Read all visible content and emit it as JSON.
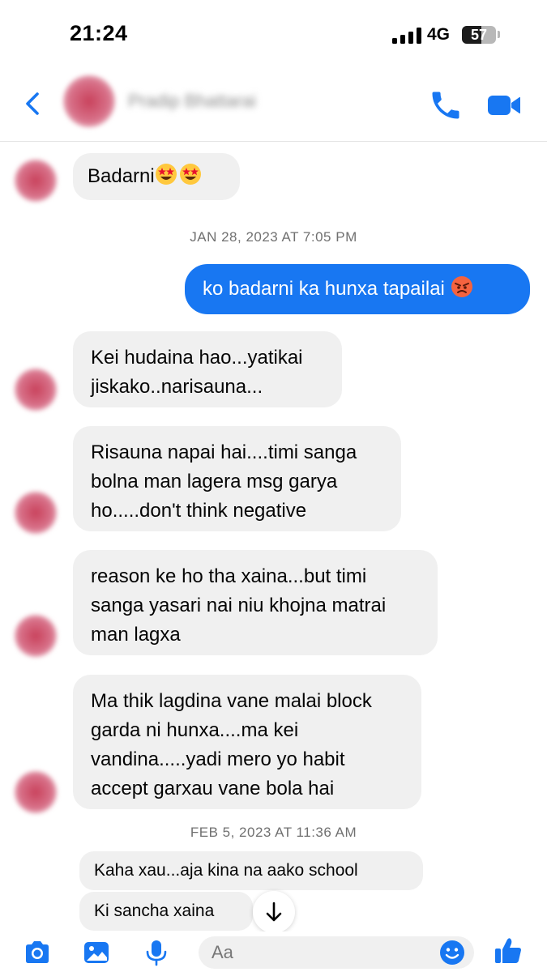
{
  "status": {
    "time": "21:24",
    "network": "4G",
    "battery": "57",
    "battery_level": 0.57
  },
  "header": {
    "contact_name": "Pradip Bhattarai"
  },
  "colors": {
    "accent": "#1877f2",
    "incoming_bubble": "#f0f0f0",
    "timestamp": "#707070"
  },
  "messages": {
    "m1": "Badarni",
    "ts1": "JAN 28, 2023 AT 7:05 PM",
    "m2": "ko badarni ka hunxa tapailai",
    "m3": "Kei hudaina hao...yatikai jiskako..narisauna...",
    "m4": "Risauna napai hai....timi sanga bolna man lagera msg garya ho.....don't think negative",
    "m5": "reason ke ho tha xaina...but timi sanga yasari nai niu khojna matrai man lagxa",
    "m6": "Ma thik lagdina vane malai block garda ni hunxa....ma kei vandina.....yadi mero yo habit accept garxau vane bola hai",
    "ts2": "FEB 5, 2023 AT 11:36 AM",
    "m7": "Kaha xau...aja kina na aako school",
    "m8": "Ki sancha xaina"
  },
  "composer": {
    "placeholder": "Aa"
  },
  "icons": [
    "back-icon",
    "phone-icon",
    "video-camera-icon",
    "star-struck-emoji-icon",
    "angry-face-emoji-icon",
    "arrow-down-icon",
    "camera-icon",
    "image-icon",
    "microphone-icon",
    "smiley-icon",
    "thumbs-up-icon"
  ]
}
